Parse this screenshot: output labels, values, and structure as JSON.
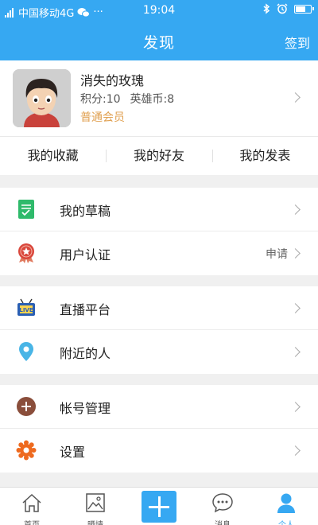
{
  "status_bar": {
    "signal_label": "4G",
    "carrier": "中国移动4G",
    "extra": "···",
    "time": "19:04"
  },
  "header": {
    "title": "发现",
    "sign_in": "签到"
  },
  "profile": {
    "name": "消失的玫瑰",
    "points": "积分:10",
    "coins": "英雄币:8",
    "member_level": "普通会员"
  },
  "quick_tabs": [
    "我的收藏",
    "我的好友",
    "我的发表"
  ],
  "menu": {
    "drafts": "我的草稿",
    "verify": "用户认证",
    "verify_extra": "申请",
    "live": "直播平台",
    "nearby": "附近的人",
    "account": "帐号管理",
    "settings": "设置"
  },
  "bottom_nav": {
    "home": "首页",
    "gallery": "晒墙",
    "messages": "消息",
    "profile": "个人"
  },
  "colors": {
    "accent": "#36a8f2",
    "member": "#e0a050"
  }
}
